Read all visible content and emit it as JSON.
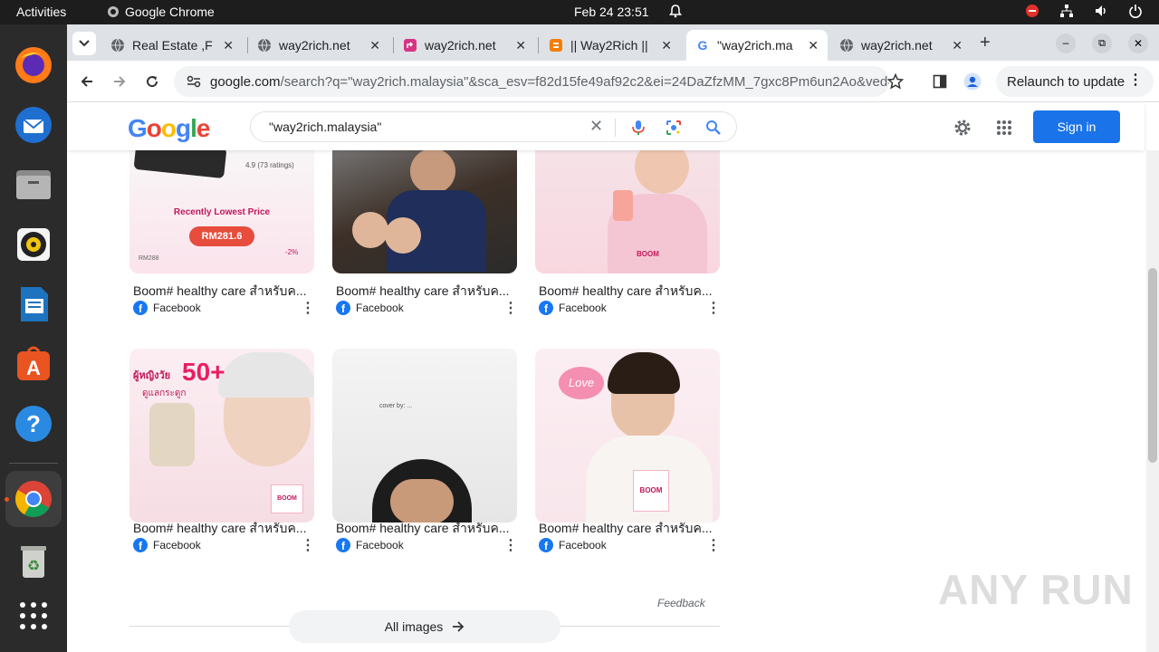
{
  "system": {
    "activities": "Activities",
    "app_name": "Google Chrome",
    "clock": "Feb 24  23:51"
  },
  "tabs": [
    {
      "title": "Real Estate ,F",
      "icon": "globe-icon"
    },
    {
      "title": "way2rich.net",
      "icon": "globe-icon"
    },
    {
      "title": "way2rich.net",
      "icon": "redirect-icon"
    },
    {
      "title": "|| Way2Rich ||",
      "icon": "blogger-icon"
    },
    {
      "title": "\"way2rich.ma",
      "icon": "google-icon"
    },
    {
      "title": "way2rich.net",
      "icon": "globe-icon"
    }
  ],
  "address": {
    "domain": "google.com",
    "path": "/search?q=\"way2rich.malaysia\"&sca_esv=f82d15fe49af92c2&ei=24DaZfzMM_7gxc8Pm6un2Ao&ved=0a..."
  },
  "relaunch_label": "Relaunch to update",
  "google": {
    "logo": "Google",
    "query": "\"way2rich.malaysia\"",
    "sign_in": "Sign in"
  },
  "results": [
    {
      "caption": "Boom# healthy care สำหรับค...",
      "source": "Facebook",
      "img_text_1": "Recently Lowest Price",
      "img_text_2": "RM281.6",
      "img_text_3": "4.9 (73 ratings)",
      "img_text_4": "RM288",
      "img_text_5": "-2%"
    },
    {
      "caption": "Boom# healthy care สำหรับค...",
      "source": "Facebook"
    },
    {
      "caption": "Boom# healthy care สำหรับค...",
      "source": "Facebook",
      "img_text_1": "BOOM"
    },
    {
      "caption": "Boom# healthy care สำหรับค...",
      "source": "Facebook",
      "img_text_1": "50+",
      "img_text_2": "ผู้หญิงวัย",
      "img_text_3": "ดูแลกระดูก",
      "img_text_4": "BOOM"
    },
    {
      "caption": "Boom# healthy care สำหรับค...",
      "source": "Facebook",
      "img_text_1": "cover by: ..."
    },
    {
      "caption": "Boom# healthy care สำหรับค...",
      "source": "Facebook",
      "img_text_1": "Love",
      "img_text_2": "BOOM"
    }
  ],
  "feedback": "Feedback",
  "all_images": "All images",
  "watermark": "ANY RUN"
}
